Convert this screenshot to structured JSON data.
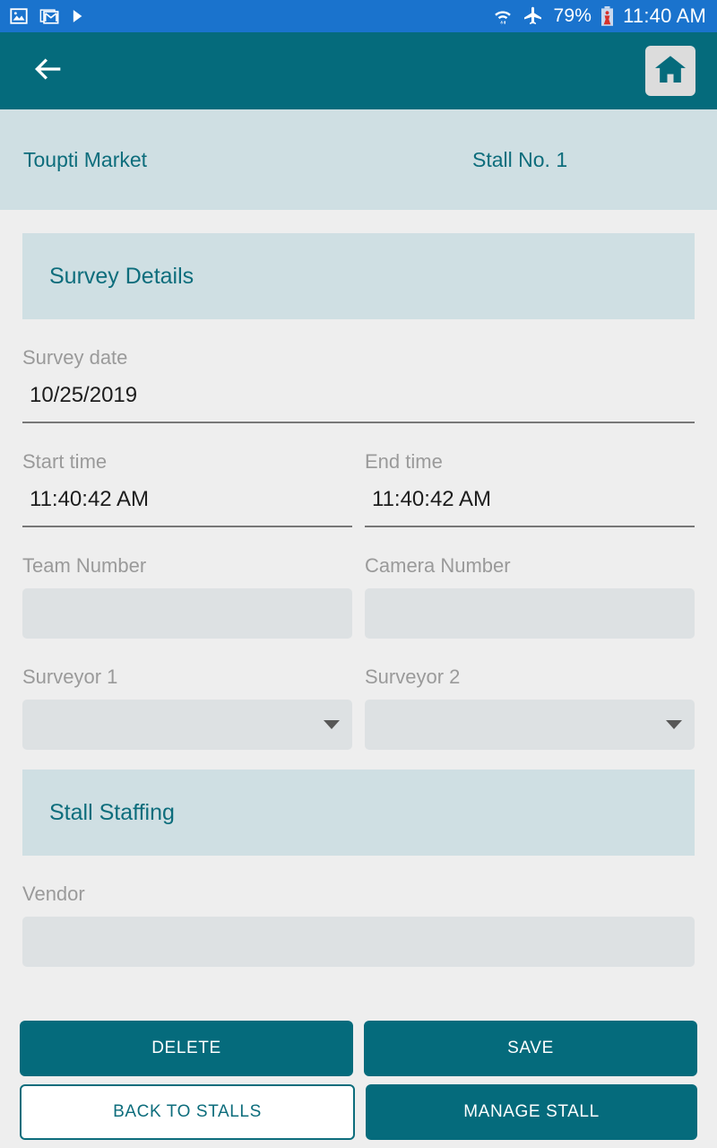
{
  "status_bar": {
    "icons_left": [
      "gallery-icon",
      "gmail-icon",
      "play-store-icon"
    ],
    "icons_right": [
      "wifi-icon",
      "airplane-mode-icon",
      "battery-icon"
    ],
    "battery_percent": "79%",
    "clock": "11:40 AM"
  },
  "app_bar": {
    "back_icon": "back-arrow-icon",
    "home_icon": "home-icon"
  },
  "sub_header": {
    "market_name": "Toupti Market",
    "stall_label": "Stall No. 1"
  },
  "sections": {
    "survey_details": {
      "title": "Survey Details",
      "survey_date": {
        "label": "Survey date",
        "value": "10/25/2019"
      },
      "start_time": {
        "label": "Start time",
        "value": "11:40:42 AM"
      },
      "end_time": {
        "label": "End time",
        "value": "11:40:42 AM"
      },
      "team_number": {
        "label": "Team Number",
        "value": ""
      },
      "camera_number": {
        "label": "Camera Number",
        "value": ""
      },
      "surveyor_1": {
        "label": "Surveyor 1",
        "value": ""
      },
      "surveyor_2": {
        "label": "Surveyor 2",
        "value": ""
      }
    },
    "stall_staffing": {
      "title": "Stall Staffing",
      "vendor": {
        "label": "Vendor",
        "value": ""
      }
    }
  },
  "buttons": {
    "delete": "DELETE",
    "save": "SAVE",
    "back_to_stalls": "BACK TO STALLS",
    "manage_stall": "MANAGE STALL"
  },
  "colors": {
    "teal": "#056b7c",
    "light_blue": "#cfdfe3",
    "status_bar_blue": "#1a73cd",
    "page_bg": "#eeeeee",
    "input_bg": "#dde1e3",
    "label_gray": "#9a9a9a"
  }
}
